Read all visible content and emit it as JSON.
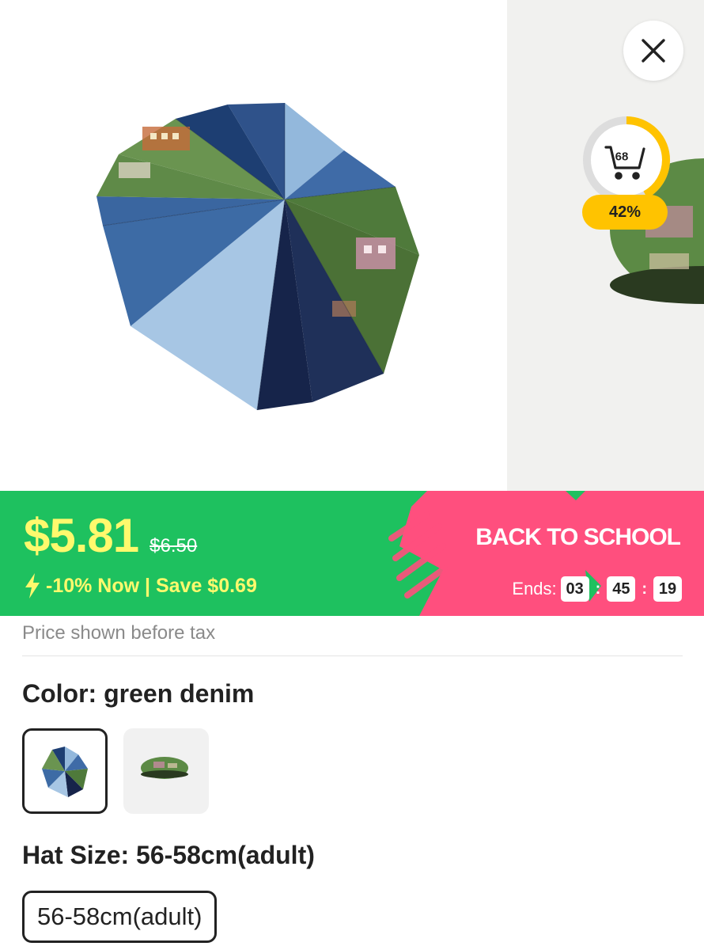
{
  "cart": {
    "count": "68",
    "percent": "42%"
  },
  "promo": {
    "price": "$5.81",
    "original_price": "$6.50",
    "discount_text": "-10% Now | Save $0.69",
    "campaign": "BACK TO SCHOOL",
    "ends_label": "Ends:",
    "countdown": {
      "hours": "03",
      "minutes": "45",
      "seconds": "19"
    },
    "colors": {
      "green": "#1ec15f",
      "pink": "#ff4f7e",
      "price_yellow": "#fff96d"
    }
  },
  "tax_note": "Price shown before tax",
  "color_section": {
    "label": "Color: green denim"
  },
  "size_section": {
    "label": "Hat Size: 56-58cm(adult)",
    "option": "56-58cm(adult)"
  },
  "icons": {
    "close": "close-icon",
    "cart": "cart-icon",
    "lightning": "lightning-icon"
  }
}
